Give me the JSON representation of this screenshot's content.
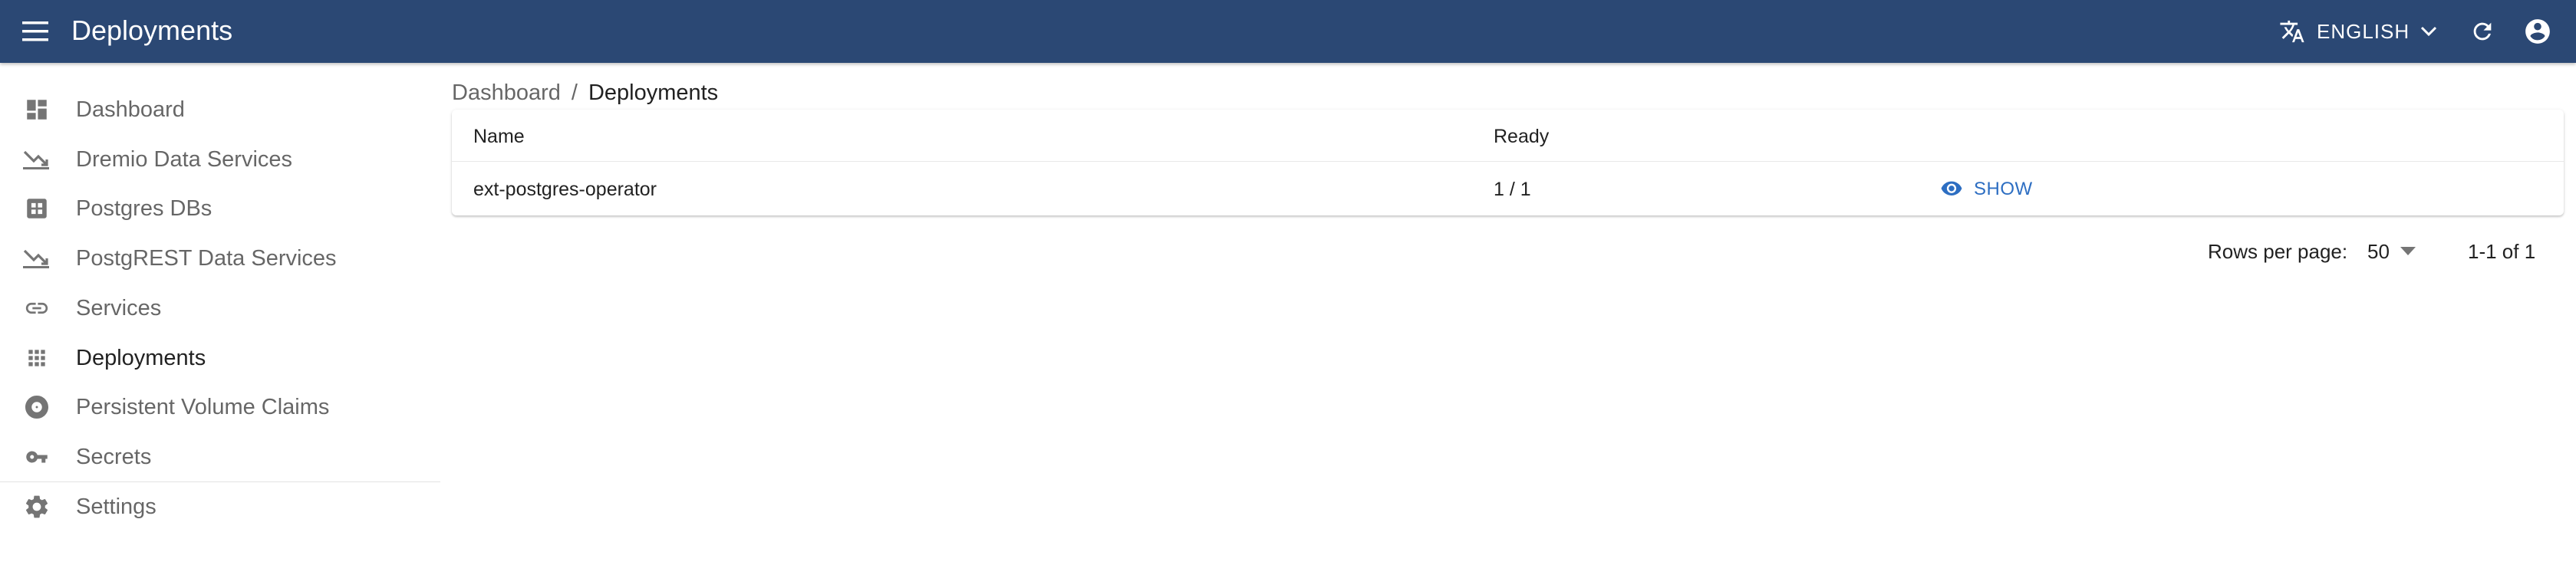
{
  "app": {
    "title": "Deployments",
    "language_label": "ENGLISH",
    "colors": {
      "appbar": "#2b4874",
      "accent": "#2d6ec2"
    },
    "icons": {
      "menu": "menu-icon",
      "language": "translate-icon",
      "refresh": "refresh-icon",
      "account": "account-circle-icon"
    }
  },
  "sidebar": {
    "items": [
      {
        "label": "Dashboard",
        "icon": "dashboard-icon"
      },
      {
        "label": "Dremio Data Services",
        "icon": "chart-down-icon"
      },
      {
        "label": "Postgres DBs",
        "icon": "grid-box-icon"
      },
      {
        "label": "PostgREST Data Services",
        "icon": "chart-down-icon"
      },
      {
        "label": "Services",
        "icon": "link-icon"
      },
      {
        "label": "Deployments",
        "icon": "apps-icon"
      },
      {
        "label": "Persistent Volume Claims",
        "icon": "disc-icon"
      },
      {
        "label": "Secrets",
        "icon": "key-icon"
      },
      {
        "label": "Settings",
        "icon": "gear-icon"
      }
    ],
    "active": "Deployments"
  },
  "breadcrumb": {
    "link": "Dashboard",
    "separator": "/",
    "current": "Deployments"
  },
  "table": {
    "columns": [
      "Name",
      "Ready"
    ],
    "rows": [
      {
        "name": "ext-postgres-operator",
        "ready": "1 / 1",
        "action": "SHOW"
      }
    ]
  },
  "pagination": {
    "rows_per_page_label": "Rows per page:",
    "rows_per_page_value": "50",
    "range": "1-1 of 1"
  }
}
